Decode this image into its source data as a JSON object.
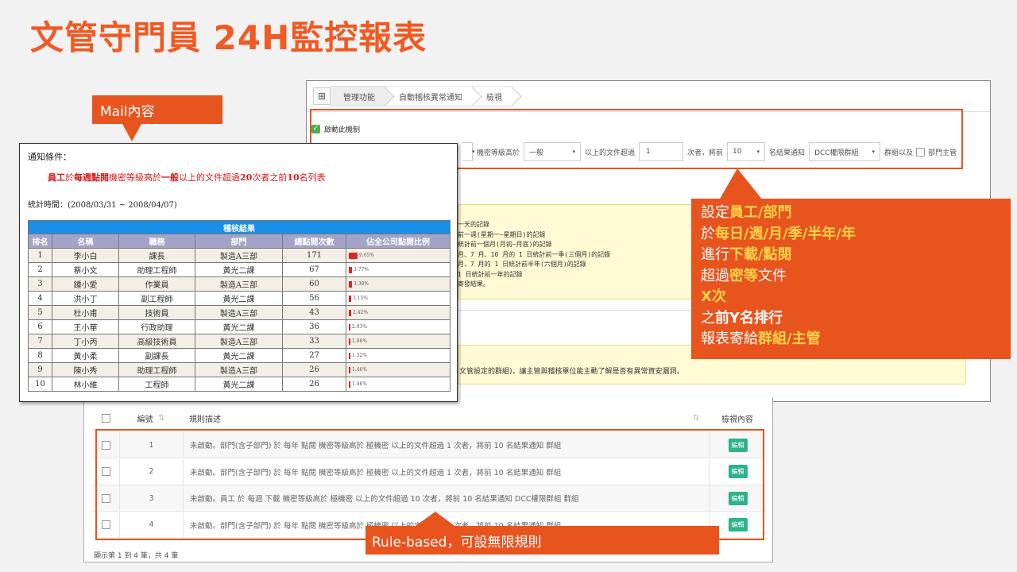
{
  "title": "文管守門員 24H監控報表",
  "admin": {
    "breadcrumb": [
      "管理功能",
      "自動稽核異常通知",
      "檢視"
    ],
    "enable_label": "啟動此機制",
    "cond": {
      "secret_label": "機密等級高於",
      "secret_value": "一般",
      "over_label": "以上的文件超過",
      "count_value": "1",
      "times_label": "次者，將前",
      "top_value": "10",
      "send_label": "名結果通知",
      "group_value": "DCC權限群組",
      "group_and_label": "群組以及",
      "manager_label": "部門主管"
    },
    "yellow_lines": [
      "一天的記錄",
      "前一週(星期一~星期日)的記錄",
      "統計前一個月(月初~月底)的記錄",
      "月、7 月、10 月的 1 日統計前一季(三個月)的記錄",
      "月、7 月的 1 日統計前半年(六個月)的記錄",
      "1 日統計前一年的記錄",
      "寄發結果。"
    ],
    "yellow_text2": "文管設定的群組)，讓主管與稽核單位能主動了解是否有異常資安漏洞。",
    "table": {
      "col_no": "編號",
      "col_desc": "規則描述",
      "col_view": "檢視內容",
      "rows": [
        {
          "no": "1",
          "desc": "未啟動。部門(含子部門) 於 每年 點閱 機密等級高於 極機密 以上的文件超過 1 次者，將前 10 名結果通知 群組",
          "btn": "編輯"
        },
        {
          "no": "2",
          "desc": "未啟動。部門(含子部門) 於 每年 點閱 機密等級高於 極機密 以上的文件超過 1 次者，將前 10 名結果通知 群組",
          "btn": "編輯"
        },
        {
          "no": "3",
          "desc": "未啟動。員工 於 每週 下載 機密等級高於 極機密 以上的文件超過 10 次者，將前 10 名結果通知 DCC權限群組 群組",
          "btn": "編輯"
        },
        {
          "no": "4",
          "desc": "未啟動。部門(含子部門) 於 每年 點閱 機密等級高於 極機密 以上的文件超過 1 次者，將前 10 名結果通知 群組",
          "btn": "編輯"
        }
      ],
      "footer": "顯示第 1 到 4 筆，共 4 筆"
    }
  },
  "mail_callout": "Mail內容",
  "mail": {
    "cond_label": "通知條件：",
    "cond_parts": [
      "員工",
      "於",
      "每週",
      "點閱",
      "機密等級高於",
      "一般",
      "以上的文件超過",
      "20",
      "次者之前",
      "10",
      "名列表"
    ],
    "period": "統計時間：(2008/03/31 ~ 2008/04/07)",
    "table_caption": "稽核結果",
    "headers": [
      "排名",
      "名稱",
      "職務",
      "部門",
      "總點閱次數",
      "佔全公司點閱比例"
    ],
    "rows": [
      {
        "rank": "1",
        "name": "李小白",
        "role": "課長",
        "dept": "製造A三部",
        "count": "171",
        "pct": "9.65%",
        "frac": 0.0965
      },
      {
        "rank": "2",
        "name": "蔡小文",
        "role": "助理工程師",
        "dept": "黃光二課",
        "count": "67",
        "pct": "3.77%",
        "frac": 0.0377
      },
      {
        "rank": "3",
        "name": "鍾小愛",
        "role": "作業員",
        "dept": "製造A三部",
        "count": "60",
        "pct": "3.38%",
        "frac": 0.0338
      },
      {
        "rank": "4",
        "name": "洪小丁",
        "role": "副工程師",
        "dept": "黃光二課",
        "count": "56",
        "pct": "3.15%",
        "frac": 0.0315
      },
      {
        "rank": "5",
        "name": "杜小甫",
        "role": "技術員",
        "dept": "製造A三部",
        "count": "43",
        "pct": "2.42%",
        "frac": 0.0242
      },
      {
        "rank": "6",
        "name": "王小華",
        "role": "行政助理",
        "dept": "黃光二課",
        "count": "36",
        "pct": "2.03%",
        "frac": 0.0203
      },
      {
        "rank": "7",
        "name": "丁小丙",
        "role": "高級技術員",
        "dept": "製造A三部",
        "count": "33",
        "pct": "1.86%",
        "frac": 0.0186
      },
      {
        "rank": "8",
        "name": "黃小柔",
        "role": "副課長",
        "dept": "黃光二課",
        "count": "27",
        "pct": "1.52%",
        "frac": 0.0152
      },
      {
        "rank": "9",
        "name": "陳小秀",
        "role": "助理工程師",
        "dept": "製造A三部",
        "count": "26",
        "pct": "1.46%",
        "frac": 0.0146
      },
      {
        "rank": "10",
        "name": "林小維",
        "role": "工程師",
        "dept": "黃光二課",
        "count": "26",
        "pct": "1.46%",
        "frac": 0.0146
      }
    ]
  },
  "right_callout": [
    [
      [
        "設定",
        "w0"
      ],
      [
        "員工/部門",
        "y"
      ]
    ],
    [
      [
        "於",
        "w0"
      ],
      [
        "每日/週/月/季/半年/年",
        "y"
      ]
    ],
    [
      [
        "進行",
        "w0"
      ],
      [
        "下載/點閱",
        "y"
      ]
    ],
    [
      [
        "超過",
        "w0"
      ],
      [
        "密等",
        "y"
      ],
      [
        "文件",
        "w0"
      ]
    ],
    [
      [
        "X次",
        "y"
      ]
    ],
    [
      [
        "之",
        "w0"
      ],
      [
        "前Y名排行",
        "w"
      ]
    ],
    [
      [
        "報表寄給",
        "w0"
      ],
      [
        "群組/主管",
        "y"
      ]
    ]
  ],
  "rule_callout": "Rule-based，可設無限規則",
  "colors": {
    "accent": "#e8541e",
    "title": "#f15a22",
    "highlight": "#ffd24a",
    "table_caption": "#1b8fe6",
    "table_header": "#a3a3c7",
    "bar": "#e02424",
    "edit_button": "#2bb38a"
  }
}
